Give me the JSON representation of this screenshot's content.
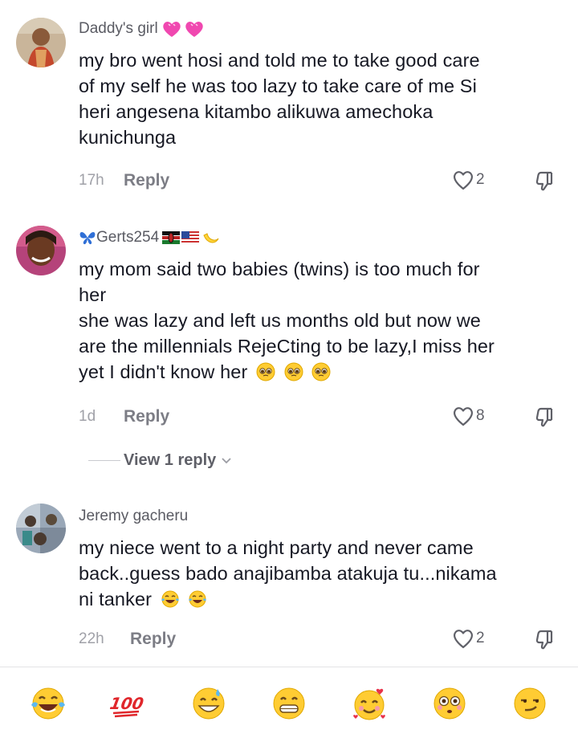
{
  "comments": [
    {
      "username": "Daddy's girl",
      "username_deco": "two pink hearts",
      "lines": [
        "my bro went hosi and told me to take good care",
        "of my self he was too lazy to take care of me Si",
        "heri angesena kitambo alikuwa amechoka",
        "kunichunga"
      ],
      "time": "17h",
      "reply_label": "Reply",
      "likes": "2"
    },
    {
      "username": "Gerts254",
      "username_deco": "butterfly, Kenya flag, USA flag, moon",
      "lines": [
        "my mom said two babies (twins) is too much for",
        "her",
        "she was lazy and left us months old but now we",
        "are the millennials RejeCting to be lazy,I miss her",
        "yet I didn't know her"
      ],
      "trailing_emoji": [
        "pleading-face",
        "pleading-face",
        "pleading-face"
      ],
      "time": "1d",
      "reply_label": "Reply",
      "likes": "8",
      "view_replies": "View 1 reply"
    },
    {
      "username": "Jeremy gacheru",
      "lines": [
        "my niece went to a night party and never came",
        "back..guess bado anajibamba atakuja tu...nikama",
        "ni tanker"
      ],
      "trailing_emoji": [
        "tears-of-joy",
        "tears-of-joy"
      ],
      "time": "22h",
      "reply_label": "Reply",
      "likes": "2"
    }
  ],
  "emoji_bar": [
    "tears-of-joy",
    "hundred-points",
    "grinning-sweat",
    "beaming-face",
    "smiling-face-with-hearts",
    "flushed-face",
    "smirking-face"
  ],
  "colors": {
    "text": "#161823",
    "muted": "#a0a1a8",
    "username": "#5a5b63",
    "emoji_yellow": "#ffcc33"
  }
}
